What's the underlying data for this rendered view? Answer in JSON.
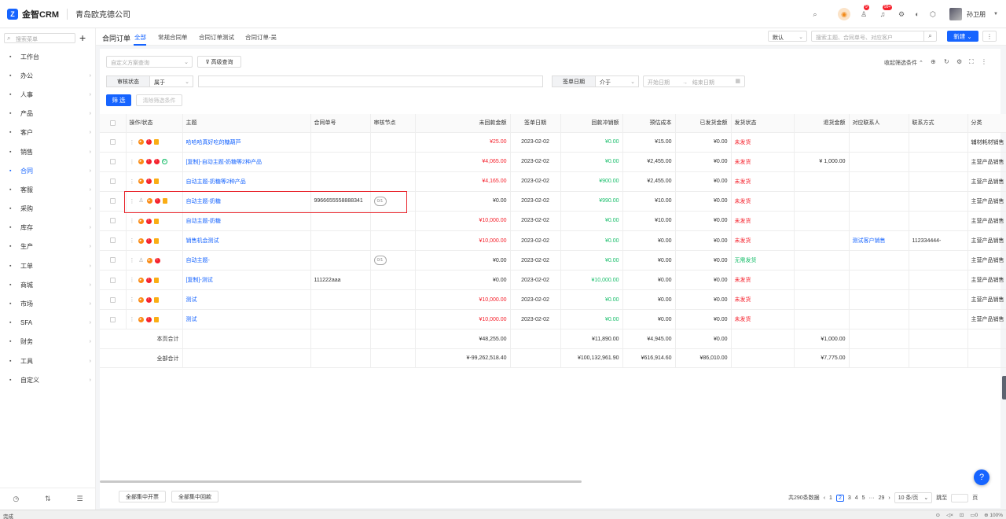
{
  "app": {
    "name": "金智CRM",
    "company": "青岛欧克德公司",
    "user": "孙卫朋",
    "badges": {
      "tasks": "9",
      "messages": "99+"
    }
  },
  "sidebar": {
    "search_placeholder": "搜索菜单",
    "items": [
      {
        "label": "工作台",
        "icon": "grid-icon",
        "has_children": false
      },
      {
        "label": "办公",
        "icon": "office-icon",
        "has_children": true
      },
      {
        "label": "人事",
        "icon": "person-icon",
        "has_children": true
      },
      {
        "label": "产品",
        "icon": "product-icon",
        "has_children": true
      },
      {
        "label": "客户",
        "icon": "customer-icon",
        "has_children": true
      },
      {
        "label": "销售",
        "icon": "sales-icon",
        "has_children": true
      },
      {
        "label": "合同",
        "icon": "contract-icon",
        "has_children": true,
        "active": true
      },
      {
        "label": "客服",
        "icon": "service-icon",
        "has_children": true
      },
      {
        "label": "采购",
        "icon": "purchase-icon",
        "has_children": true
      },
      {
        "label": "库存",
        "icon": "stock-icon",
        "has_children": true
      },
      {
        "label": "生产",
        "icon": "production-icon",
        "has_children": true
      },
      {
        "label": "工单",
        "icon": "ticket-icon",
        "has_children": true
      },
      {
        "label": "商城",
        "icon": "mall-icon",
        "has_children": true
      },
      {
        "label": "市场",
        "icon": "market-icon",
        "has_children": true
      },
      {
        "label": "SFA",
        "icon": "sfa-icon",
        "has_children": true
      },
      {
        "label": "财务",
        "icon": "finance-icon",
        "has_children": true
      },
      {
        "label": "工具",
        "icon": "tool-icon",
        "has_children": true
      },
      {
        "label": "自定义",
        "icon": "custom-icon",
        "has_children": true
      }
    ]
  },
  "header": {
    "title": "合同订单",
    "tabs": [
      "全部",
      "常规合同单",
      "合同订单测试",
      "合同订单-吴"
    ],
    "view_select": "默认",
    "search_placeholder": "搜索主题、合同单号、对应客户",
    "new_label": "新建",
    "more_label": "⋮"
  },
  "filters": {
    "scheme_placeholder": "自定义方案查询",
    "advanced_label": "高级查询",
    "collapse_label": "收起筛选条件",
    "audit_label": "审核状态",
    "audit_op": "属于",
    "sign_date_label": "签单日期",
    "date_op": "介于",
    "start_placeholder": "开始日期",
    "range_sep": "→",
    "end_placeholder": "结束日期",
    "filter_btn": "筛 选",
    "clear_btn": "清除筛选条件"
  },
  "table": {
    "columns": [
      "操作/状态",
      "主题",
      "合同单号",
      "审核节点",
      "未回款金额",
      "签单日期",
      "回款冲销额",
      "预估成本",
      "已发货金额",
      "发货状态",
      "退货金额",
      "对应联系人",
      "联系方式",
      "分类"
    ],
    "rows": [
      {
        "subject": "哈哈哈真好吃的糖葫芦",
        "number": "",
        "node": "",
        "unpaid": "¥25.00",
        "unpaid_color": "red",
        "date": "2023-02-02",
        "writeoff": "¥0.00",
        "cost": "¥15.00",
        "shipped": "¥0.00",
        "ship_status": "未发货",
        "ship_color": "red",
        "refund": "",
        "contact": "",
        "phone": "",
        "category": "辅材耗材销售",
        "icons": [
          "o",
          "r",
          "y"
        ]
      },
      {
        "subject": "[复制]-自动主题-奶糖等2种产品",
        "number": "",
        "node": "",
        "unpaid": "¥4,065.00",
        "unpaid_color": "red",
        "date": "2023-02-02",
        "writeoff": "¥0.00",
        "cost": "¥2,455.00",
        "shipped": "¥0.00",
        "ship_status": "未发货",
        "ship_color": "red",
        "refund": "¥ 1,000.00",
        "contact": "",
        "phone": "",
        "category": "主营产品销售",
        "icons": [
          "o",
          "r",
          "r",
          "g"
        ]
      },
      {
        "subject": "自动主题-奶糖等2种产品",
        "number": "",
        "node": "",
        "unpaid": "¥4,165.00",
        "unpaid_color": "red",
        "date": "2023-02-02",
        "writeoff": "¥900.00",
        "cost": "¥2,455.00",
        "shipped": "¥0.00",
        "ship_status": "未发货",
        "ship_color": "red",
        "refund": "",
        "contact": "",
        "phone": "",
        "category": "主营产品销售",
        "icons": [
          "o",
          "r",
          "y"
        ]
      },
      {
        "subject": "自动主题-奶糖",
        "number": "9966655558888341",
        "node": "0/1",
        "unpaid": "¥0.00",
        "unpaid_color": "",
        "date": "2023-02-02",
        "writeoff": "¥990.00",
        "cost": "¥10.00",
        "shipped": "¥0.00",
        "ship_status": "未发货",
        "ship_color": "red",
        "refund": "",
        "contact": "",
        "phone": "",
        "category": "主营产品销售",
        "icons": [
          "gr",
          "o",
          "r",
          "y"
        ]
      },
      {
        "subject": "自动主题-奶糖",
        "number": "",
        "node": "",
        "unpaid": "¥10,000.00",
        "unpaid_color": "red",
        "date": "2023-02-02",
        "writeoff": "¥0.00",
        "cost": "¥10.00",
        "shipped": "¥0.00",
        "ship_status": "未发货",
        "ship_color": "red",
        "refund": "",
        "contact": "",
        "phone": "",
        "category": "主营产品销售",
        "icons": [
          "o",
          "r",
          "y"
        ]
      },
      {
        "subject": "销售机会测试",
        "number": "",
        "node": "",
        "unpaid": "¥10,000.00",
        "unpaid_color": "red",
        "date": "2023-02-02",
        "writeoff": "¥0.00",
        "cost": "¥0.00",
        "shipped": "¥0.00",
        "ship_status": "未发货",
        "ship_color": "red",
        "refund": "",
        "contact": "测试客户销售",
        "phone": "112334444-",
        "category": "主营产品销售",
        "icons": [
          "o",
          "r",
          "y"
        ]
      },
      {
        "subject": "自动主题-",
        "number": "",
        "node": "0/1",
        "unpaid": "¥0.00",
        "unpaid_color": "",
        "date": "2023-02-02",
        "writeoff": "¥0.00",
        "cost": "¥0.00",
        "shipped": "¥0.00",
        "ship_status": "无需发货",
        "ship_color": "green",
        "refund": "",
        "contact": "",
        "phone": "",
        "category": "主营产品销售",
        "icons": [
          "gr",
          "o",
          "r"
        ]
      },
      {
        "subject": "[复制]-测试",
        "number": "111222aaa",
        "node": "",
        "unpaid": "¥0.00",
        "unpaid_color": "",
        "date": "2023-02-02",
        "writeoff": "¥10,000.00",
        "cost": "¥0.00",
        "shipped": "¥0.00",
        "ship_status": "未发货",
        "ship_color": "red",
        "refund": "",
        "contact": "",
        "phone": "",
        "category": "主营产品销售",
        "icons": [
          "o",
          "r",
          "y"
        ]
      },
      {
        "subject": "测试",
        "number": "",
        "node": "",
        "unpaid": "¥10,000.00",
        "unpaid_color": "red",
        "date": "2023-02-02",
        "writeoff": "¥0.00",
        "cost": "¥0.00",
        "shipped": "¥0.00",
        "ship_status": "未发货",
        "ship_color": "red",
        "refund": "",
        "contact": "",
        "phone": "",
        "category": "主营产品销售",
        "icons": [
          "o",
          "r",
          "y"
        ]
      },
      {
        "subject": "测试",
        "number": "",
        "node": "",
        "unpaid": "¥10,000.00",
        "unpaid_color": "red",
        "date": "2023-02-02",
        "writeoff": "¥0.00",
        "cost": "¥0.00",
        "shipped": "¥0.00",
        "ship_status": "未发货",
        "ship_color": "red",
        "refund": "",
        "contact": "",
        "phone": "",
        "category": "主营产品销售",
        "icons": [
          "o",
          "r",
          "y"
        ]
      }
    ],
    "page_total": {
      "label": "本页合计",
      "unpaid": "¥48,255.00",
      "writeoff": "¥11,890.00",
      "cost": "¥4,945.00",
      "shipped": "¥0.00",
      "refund": "¥1,000.00"
    },
    "grand_total": {
      "label": "全部合计",
      "unpaid": "¥-99,262,518.40",
      "writeoff": "¥100,132,961.90",
      "cost": "¥616,914.60",
      "shipped": "¥86,010.00",
      "refund": "¥7,775.00"
    }
  },
  "footer": {
    "btn_invoice": "全部集中开票",
    "btn_collect": "全部集中回款",
    "total": "共290条数据",
    "pages": [
      "1",
      "2",
      "3",
      "4",
      "5",
      "···",
      "29"
    ],
    "current_page": "2",
    "page_size": "10 条/页",
    "jump_label": "跳至",
    "page_unit": "页"
  },
  "status": {
    "text": "完成",
    "zoom": "100%"
  },
  "colors": {
    "accent": "#1664ff",
    "red": "#f5222d",
    "green": "#19be6b"
  }
}
